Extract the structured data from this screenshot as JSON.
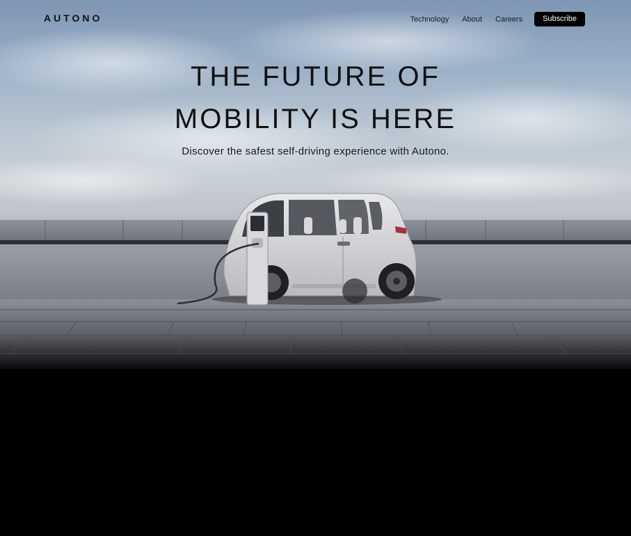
{
  "nav": {
    "logo": "AUTONO",
    "links": [
      "Technology",
      "About",
      "Careers"
    ],
    "cta": "Subscribe"
  },
  "hero": {
    "headline_line1": "THE FUTURE OF",
    "headline_line2": "MOBILITY IS HERE",
    "subtitle": "Discover the safest self-driving experience with Autono."
  },
  "colors": {
    "sky_top": "#7e95b4",
    "sky_mid": "#c9d0d6",
    "ground": "#5f636a",
    "button": "#000000",
    "text": "#111111"
  },
  "icons": {
    "hero_image": "electric-car-charging-image"
  }
}
